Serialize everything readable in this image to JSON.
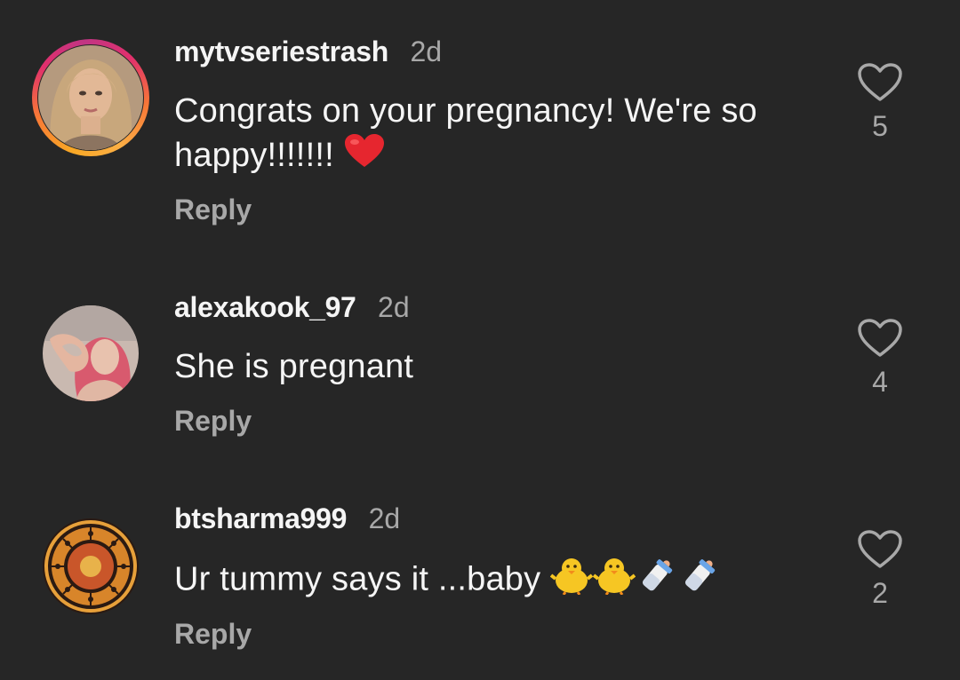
{
  "comments": [
    {
      "username": "mytvseriestrash",
      "time": "2d",
      "text": "Congrats on your pregnancy! We're so happy!!!!!!!",
      "reply_label": "Reply",
      "likes": "5",
      "avatar": "woman-portrait",
      "has_story_ring": true,
      "emojis": [
        "red-heart"
      ]
    },
    {
      "username": "alexakook_97",
      "time": "2d",
      "text": "She is pregnant",
      "reply_label": "Reply",
      "likes": "4",
      "avatar": "heart-hands-portrait",
      "has_story_ring": false,
      "emojis": []
    },
    {
      "username": "btsharma999",
      "time": "2d",
      "text": "Ur tummy says it ...baby",
      "reply_label": "Reply",
      "likes": "2",
      "avatar": "zodiac-wheel",
      "has_story_ring": false,
      "emojis": [
        "chick",
        "chick",
        "baby-bottle",
        "baby-bottle"
      ]
    }
  ],
  "colors": {
    "background": "#262626",
    "primary_text": "#f5f5f5",
    "secondary_text": "#a8a8a8",
    "heart_emoji": "#e6262f"
  }
}
